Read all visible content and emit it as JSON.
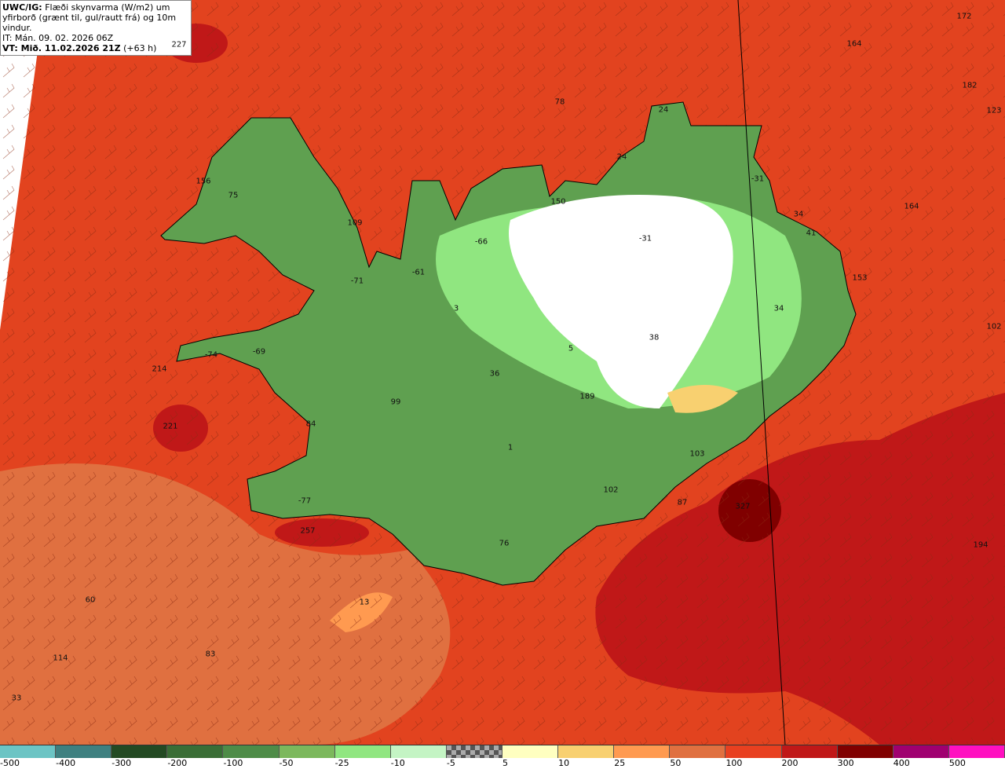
{
  "header": {
    "source": "UWC/IG:",
    "title_line1": "Flæði skynvarma (W/m2) um",
    "title_line2": "yfirborð (grænt til, gul/rautt frá) og 10m vindur.",
    "it": "IT: Mán. 09. 02. 2026 06Z",
    "vt": "VT: Mið. 11.02.2026 21Z",
    "lead": "(+63 h)"
  },
  "map": {
    "colors": {
      "ocean": "#e2431f",
      "land_green": "#5fa050",
      "land_light": "#90e680",
      "snow": "#ffffff",
      "dark_red": "#c01818",
      "orange": "#e07040"
    },
    "labels": [
      "227",
      "172",
      "164",
      "78",
      "182",
      "123",
      "24",
      "24",
      "156",
      "75",
      "150",
      "-31",
      "164",
      "34",
      "109",
      "41",
      "-66",
      "-31",
      "-61",
      "153",
      "-71",
      "3",
      "34",
      "102",
      "38",
      "5",
      "214",
      "-74",
      "-69",
      "36",
      "189",
      "99",
      "221",
      "84",
      "103",
      "1",
      "102",
      "-77",
      "327",
      "87",
      "257",
      "76",
      "194",
      "60",
      "13",
      "83",
      "114",
      "33"
    ]
  },
  "legend": {
    "colors": [
      "#6cc4c4",
      "#3e8080",
      "#234a23",
      "#3a6e36",
      "#4e8c48",
      "#7cb85c",
      "#90e680",
      "#c4f4c4",
      "checker",
      "#ffffc0",
      "#f8d070",
      "#ff9a50",
      "#e07040",
      "#e84020",
      "#c01818",
      "#800000",
      "#a00070",
      "#ff10c0"
    ],
    "ticks": [
      "-500",
      "-400",
      "-300",
      "-200",
      "-100",
      "-50",
      "-25",
      "-10",
      "-5",
      "5",
      "10",
      "25",
      "50",
      "100",
      "200",
      "300",
      "400",
      "500"
    ]
  }
}
